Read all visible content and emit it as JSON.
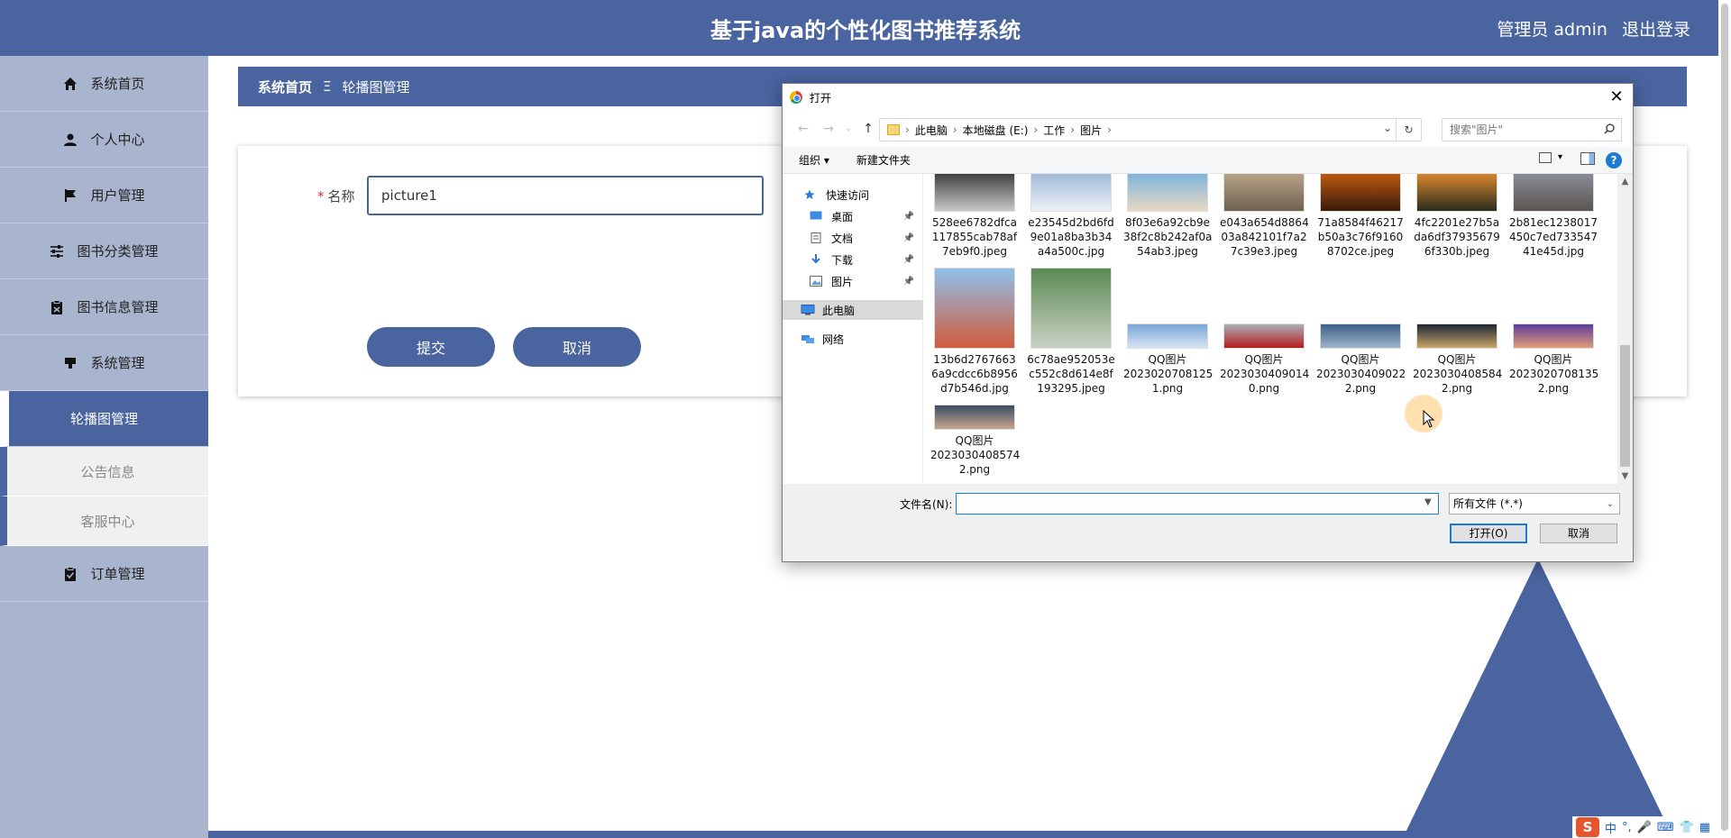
{
  "header": {
    "title": "基于java的个性化图书推荐系统",
    "admin_label": "管理员 admin",
    "logout": "退出登录"
  },
  "sidebar": {
    "items": [
      {
        "label": "系统首页",
        "icon": "home-icon"
      },
      {
        "label": "个人中心",
        "icon": "user-icon"
      },
      {
        "label": "用户管理",
        "icon": "flag-icon"
      },
      {
        "label": "图书分类管理",
        "icon": "sliders-icon"
      },
      {
        "label": "图书信息管理",
        "icon": "clipboard-icon"
      },
      {
        "label": "系统管理",
        "icon": "monitor-icon"
      },
      {
        "label": "轮播图管理",
        "icon": "",
        "active": true
      },
      {
        "label": "公告信息",
        "sub": true
      },
      {
        "label": "客服中心",
        "sub": true
      },
      {
        "label": "订单管理",
        "icon": "clipboard-check-icon"
      }
    ]
  },
  "breadcrumb": {
    "home": "系统首页",
    "separator": "Ξ",
    "current": "轮播图管理"
  },
  "form": {
    "name_label": "名称",
    "required_mark": "*",
    "name_value": "picture1",
    "submit": "提交",
    "cancel": "取消"
  },
  "dialog": {
    "title": "打开",
    "close": "✕",
    "path": [
      "此电脑",
      "本地磁盘 (E:)",
      "工作",
      "图片"
    ],
    "search_placeholder": "搜索\"图片\"",
    "organize": "组织 ▾",
    "new_folder": "新建文件夹",
    "tree": [
      {
        "label": "快速访问",
        "icon": "star-icon"
      },
      {
        "label": "桌面",
        "icon": "desktop-icon",
        "pinned": true
      },
      {
        "label": "文档",
        "icon": "document-icon",
        "pinned": true
      },
      {
        "label": "下载",
        "icon": "download-icon",
        "pinned": true
      },
      {
        "label": "图片",
        "icon": "pictures-icon",
        "pinned": true
      },
      {
        "label": "此电脑",
        "icon": "computer-icon",
        "selected": true
      },
      {
        "label": "网络",
        "icon": "network-icon"
      }
    ],
    "files": [
      {
        "name": "528ee6782dfca117855cab78af7eb9f0.jpeg",
        "lines": [
          "528ee6782dfca",
          "117855cab78af",
          "7eb9f0.jpeg"
        ],
        "colors": [
          "#3a3a3a",
          "#c9c9c9"
        ]
      },
      {
        "name": "e23545d2bd6fd9e01a8ba3b34a4a500c.jpg",
        "lines": [
          "e23545d2bd6fd",
          "9e01a8ba3b34",
          "a4a500c.jpg"
        ],
        "colors": [
          "#9fb7d6",
          "#eef2f7"
        ]
      },
      {
        "name": "8f03e6a92cb9e38f2c8b242af0a54ab3.jpeg",
        "lines": [
          "8f03e6a92cb9e",
          "38f2c8b242af0a",
          "54ab3.jpeg"
        ],
        "colors": [
          "#7ab3dc",
          "#e8d9c4"
        ]
      },
      {
        "name": "e043a654d886403a842101f7a27c39e3.jpeg",
        "lines": [
          "e043a654d8864",
          "03a842101f7a2",
          "7c39e3.jpeg"
        ],
        "colors": [
          "#b9a58a",
          "#6e6250"
        ]
      },
      {
        "name": "71a8584f46217b50a3c76f91608702ce.jpeg",
        "lines": [
          "71a8584f46217",
          "b50a3c76f9160",
          "8702ce.jpeg"
        ],
        "colors": [
          "#c25b12",
          "#3a1b08"
        ]
      },
      {
        "name": "4fc2201e27b5ada6df379356796f330b.jpeg",
        "lines": [
          "4fc2201e27b5a",
          "da6df37935679",
          "6f330b.jpeg"
        ],
        "colors": [
          "#e08a2e",
          "#2b2d1e"
        ]
      },
      {
        "name": "2b81ec1238017450c7ed73354741e45d.jpg",
        "lines": [
          "2b81ec1238017",
          "450c7ed733547",
          "41e45d.jpg"
        ],
        "colors": [
          "#8a8f9a",
          "#5b5550"
        ]
      },
      {
        "name": "13b6d27676636a9cdcc6b8956d7b546d.jpg",
        "lines": [
          "13b6d2767663",
          "6a9cdcc6b8956",
          "d7b546d.jpg"
        ],
        "colors": [
          "#8fc0ea",
          "#d05b3c"
        ]
      },
      {
        "name": "6c78ae952053ec552c8d614e8f193295.jpeg",
        "lines": [
          "6c78ae952053e",
          "c552c8d614e8f",
          "193295.jpeg"
        ],
        "colors": [
          "#5c8a54",
          "#c9d2c4"
        ]
      },
      {
        "name": "QQ图片20230207081251.png",
        "lines": [
          "QQ图片",
          "2023020708125",
          "1.png"
        ],
        "colors": [
          "#78a6d8",
          "#d7e4f1"
        ]
      },
      {
        "name": "QQ图片20230304090140.png",
        "lines": [
          "QQ图片",
          "2023030409014",
          "0.png"
        ],
        "colors": [
          "#aab0b6",
          "#b51b1b"
        ]
      },
      {
        "name": "QQ图片20230304090222.png",
        "lines": [
          "QQ图片",
          "2023030409022",
          "2.png"
        ],
        "colors": [
          "#3c5f8a",
          "#9fb4c8"
        ]
      },
      {
        "name": "QQ图片20230304085842.png",
        "lines": [
          "QQ图片",
          "2023030408584",
          "2.png"
        ],
        "colors": [
          "#1d2433",
          "#c9a66a"
        ]
      },
      {
        "name": "QQ图片20230207081352.png",
        "lines": [
          "QQ图片",
          "2023020708135",
          "2.png"
        ],
        "colors": [
          "#5b3e9a",
          "#e29b7c"
        ]
      },
      {
        "name": "QQ图片20230304085742.png",
        "lines": [
          "QQ图片",
          "2023030408574",
          "2.png"
        ],
        "colors": [
          "#3a4d66",
          "#c7a58a"
        ]
      }
    ],
    "filename_label": "文件名(N):",
    "filename_value": "",
    "filetype": "所有文件 (*.*)",
    "open": "打开(O)",
    "cancel": "取消"
  },
  "tray": {
    "ime": "S",
    "lang": "中"
  },
  "colors": {
    "primary": "#4a64a0",
    "sidebar": "#a9b4cf"
  }
}
